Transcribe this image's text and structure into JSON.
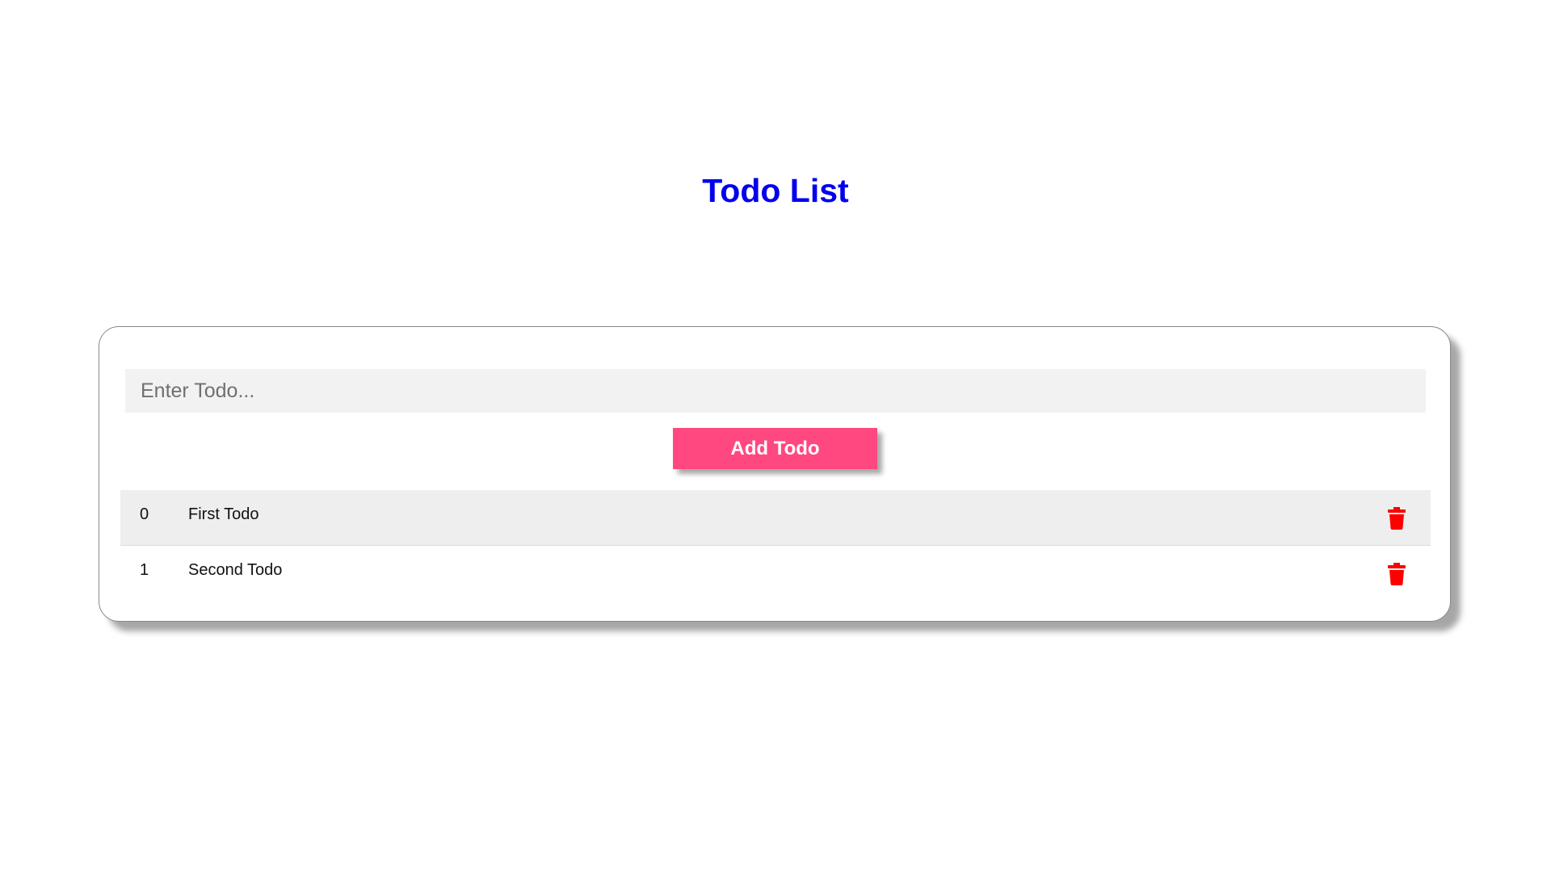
{
  "header": {
    "title": "Todo List"
  },
  "form": {
    "input_placeholder": "Enter Todo...",
    "input_value": "",
    "add_button_label": "Add Todo"
  },
  "todos": [
    {
      "index": "0",
      "text": "First Todo"
    },
    {
      "index": "1",
      "text": "Second Todo"
    }
  ],
  "icons": {
    "delete": "trash-icon"
  },
  "colors": {
    "title": "#0000ee",
    "add_button": "#ff4880",
    "delete_icon": "#ff0000",
    "input_background": "#f2f2f2",
    "alt_row": "#eeeeee"
  }
}
